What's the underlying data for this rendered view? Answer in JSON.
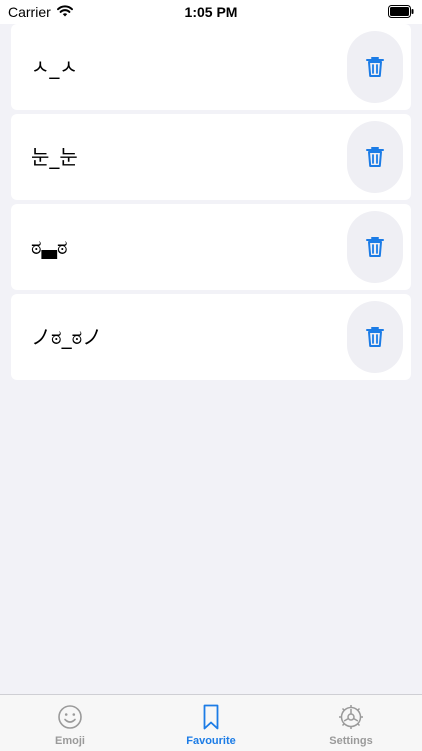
{
  "status_bar": {
    "carrier": "Carrier",
    "time": "1:05 PM",
    "wifi_icon": "wifi-icon",
    "battery_icon": "battery-full-icon"
  },
  "favourites": {
    "items": [
      {
        "text": "ㅅ_ㅅ"
      },
      {
        "text": "눈_눈"
      },
      {
        "text": "ಠ▃ಠ"
      },
      {
        "text": "ノಠ_ಠノ"
      }
    ],
    "delete_icon": "trash-icon"
  },
  "tab_bar": {
    "tabs": [
      {
        "label": "Emoji",
        "icon": "smiley-icon",
        "active": false
      },
      {
        "label": "Favourite",
        "icon": "bookmark-icon",
        "active": true
      },
      {
        "label": "Settings",
        "icon": "gear-icon",
        "active": false
      }
    ]
  },
  "colors": {
    "accent": "#1c7ce6",
    "inactive": "#9a9a9a",
    "background": "#f2f2f7",
    "delete_button_bg": "#efeff4"
  }
}
